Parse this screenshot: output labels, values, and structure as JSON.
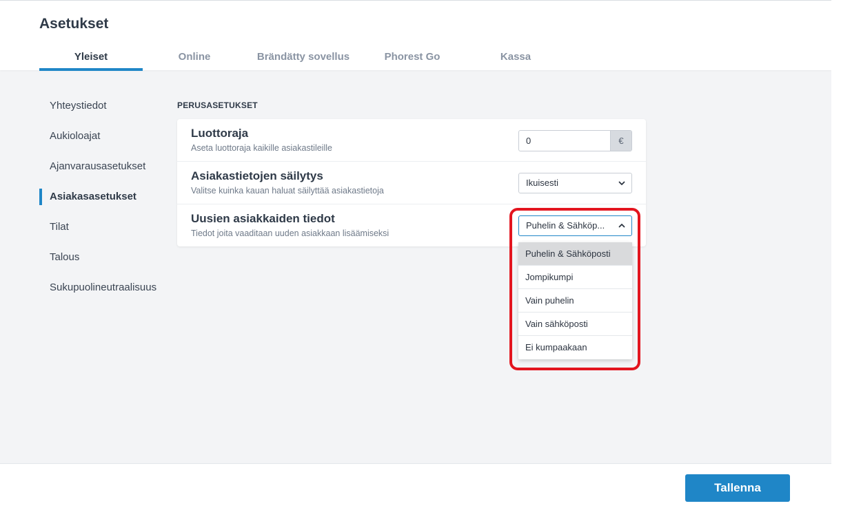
{
  "page": {
    "title": "Asetukset"
  },
  "tabs": [
    {
      "label": "Yleiset",
      "active": true
    },
    {
      "label": "Online"
    },
    {
      "label": "Brändätty sovellus"
    },
    {
      "label": "Phorest Go"
    },
    {
      "label": "Kassa"
    }
  ],
  "sidebar": {
    "items": [
      {
        "label": "Yhteystiedot"
      },
      {
        "label": "Aukioloajat"
      },
      {
        "label": "Ajanvarausasetukset"
      },
      {
        "label": "Asiakasasetukset",
        "active": true
      },
      {
        "label": "Tilat"
      },
      {
        "label": "Talous"
      },
      {
        "label": "Sukupuolineutraalisuus"
      }
    ]
  },
  "section": {
    "title": "PERUSASETUKSET"
  },
  "settings": {
    "credit_limit": {
      "title": "Luottoraja",
      "description": "Aseta luottoraja kaikille asiakastileille",
      "value": "0",
      "unit": "€"
    },
    "retention": {
      "title": "Asiakastietojen säilytys",
      "description": "Valitse kuinka kauan haluat säilyttää asiakastietoja",
      "selected": "Ikuisesti"
    },
    "new_client_info": {
      "title": "Uusien asiakkaiden tiedot",
      "description": "Tiedot joita vaaditaan uuden asiakkaan lisäämiseksi",
      "selected": "Puhelin & Sähköp...",
      "options": [
        "Puhelin & Sähköposti",
        "Jompikumpi",
        "Vain puhelin",
        "Vain sähköposti",
        "Ei kumpaakaan"
      ]
    }
  },
  "footer": {
    "save_label": "Tallenna"
  },
  "colors": {
    "accent": "#1f86c7",
    "highlight": "#e3151f",
    "background": "#f3f4f6"
  },
  "icons": {
    "chevron_down": "chevron-down-icon",
    "chevron_up": "chevron-up-icon"
  }
}
